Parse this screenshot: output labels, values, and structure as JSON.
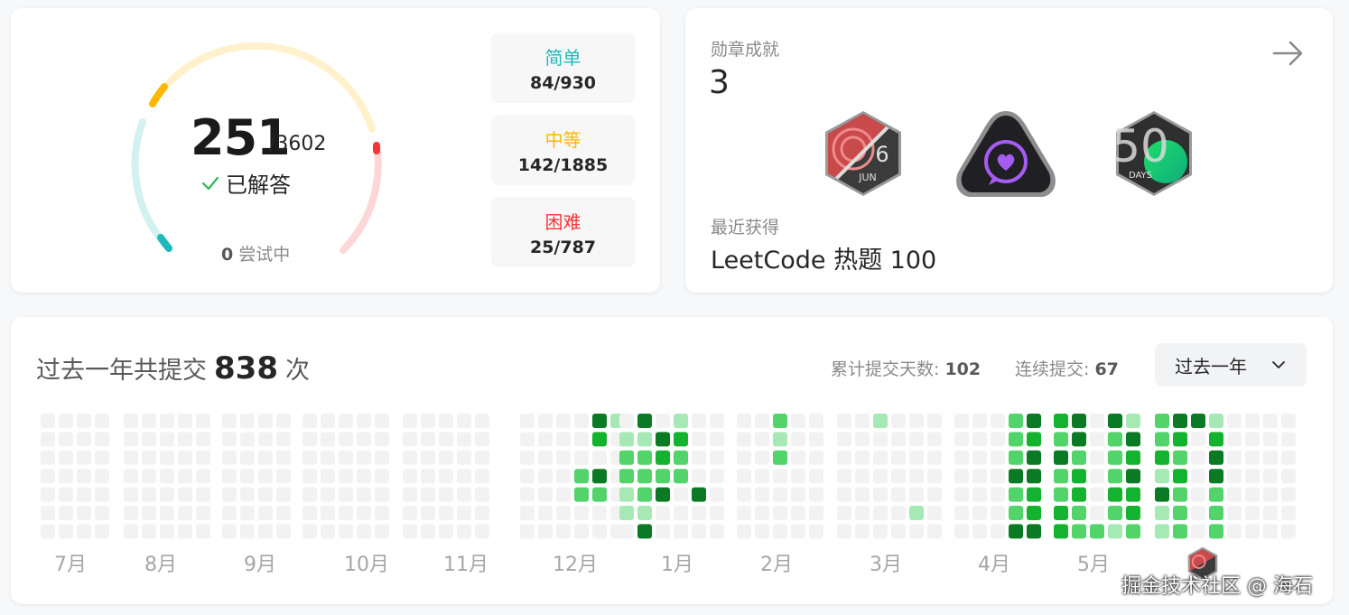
{
  "progress": {
    "solved": "251",
    "total": "/3602",
    "solved_label": "已解答",
    "attempting_count": "0",
    "attempting_label": "尝试中",
    "difficulties": [
      {
        "label": "简单",
        "count": "84/930",
        "color": "#1cbaba"
      },
      {
        "label": "中等",
        "count": "142/1885",
        "color": "#ffb700"
      },
      {
        "label": "困难",
        "count": "25/787",
        "color": "#f63636"
      }
    ]
  },
  "badges": {
    "title": "勋章成就",
    "count": "3",
    "items": [
      "daily-challenge-jun-badge-icon",
      "heart-chat-badge-icon",
      "50-days-badge-icon"
    ],
    "jun_day": "6",
    "jun_month": "JUN",
    "days_num": "50",
    "days_label": "DAYS",
    "recent_title": "最近获得",
    "recent_name": "LeetCode 热题 100"
  },
  "calendar": {
    "title_prefix": "过去一年共提交",
    "total": "838",
    "title_suffix": "次",
    "days_label": "累计提交天数:",
    "days_value": "102",
    "streak_label": "连续提交:",
    "streak_value": "67",
    "range": "过去一年",
    "months": [
      "7月",
      "8月",
      "9月",
      "10月",
      "11月",
      "12月",
      "1月",
      "2月",
      "3月",
      "4月",
      "5月"
    ],
    "colors": {
      "empty": "#f2f2f2",
      "l1": "#a6e9b5",
      "l2": "#52d46a",
      "l3": "#14b32f",
      "l4": "#0a7a25"
    }
  },
  "watermark": "掘金技术社区 @ 海石"
}
